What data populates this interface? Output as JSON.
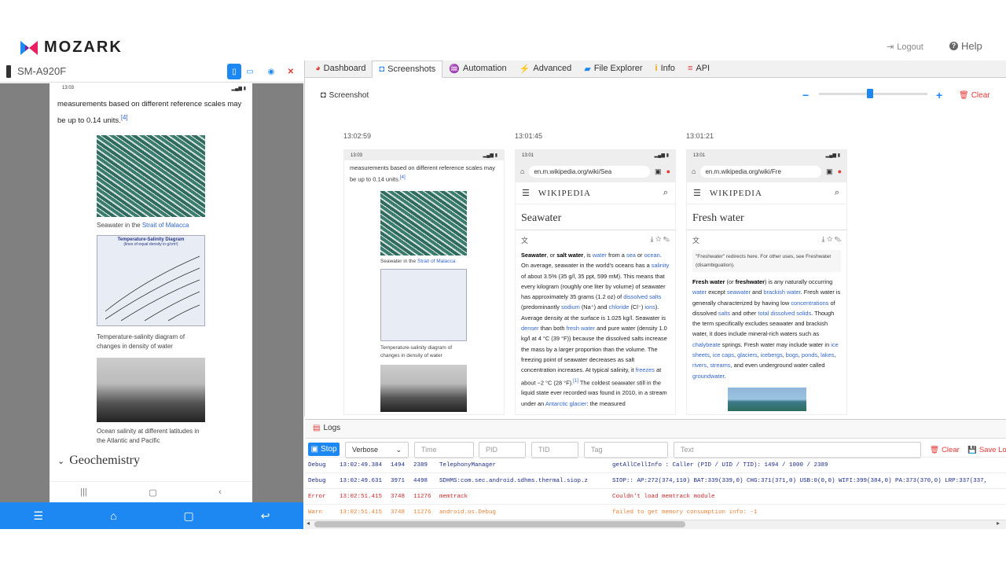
{
  "brand": {
    "name": "MOZARK",
    "logout": "Logout",
    "help": "Help"
  },
  "device": {
    "name": "SM-A920F"
  },
  "tabs": [
    {
      "label": "Dashboard",
      "icon": "dashboard-icon"
    },
    {
      "label": "Screenshots",
      "icon": "camera-icon",
      "active": true
    },
    {
      "label": "Automation",
      "icon": "automation-icon"
    },
    {
      "label": "Advanced",
      "icon": "bolt-icon"
    },
    {
      "label": "File Explorer",
      "icon": "folder-icon"
    },
    {
      "label": "Info",
      "icon": "info-icon"
    },
    {
      "label": "API",
      "icon": "api-icon"
    }
  ],
  "screenshot_toolbar": {
    "button": "Screenshot",
    "minus": "−",
    "plus": "+",
    "clear": "Clear"
  },
  "phone": {
    "status_time": "13:03",
    "intro": "measurements based on different reference scales may be up to 0.14 units.",
    "intro_ref": "[4]",
    "cap1_prefix": "Seawater in the ",
    "cap1_link": "Strait of Malacca",
    "chart_title": "Temperature-Salinity Diagram",
    "chart_sub": "(lines of equal density in g/cm³)",
    "cap2": "Temperature-salinity diagram of changes in density of water",
    "cap3": "Ocean salinity at different latitudes in the Atlantic and Pacific",
    "section": "Geochemistry"
  },
  "shots": [
    {
      "time": "13:02:59"
    },
    {
      "time": "13:01:45",
      "url": "en.m.wikipedia.org/wiki/Sea",
      "brand": "WIKIPEDIA",
      "title": "Seawater"
    },
    {
      "time": "13:01:21",
      "url": "en.m.wikipedia.org/wiki/Fre",
      "brand": "WIKIPEDIA",
      "title": "Fresh water",
      "hatnote": "\"Freshwater\" redirects here. For other uses, see Freshwater (disambiguation)."
    }
  ],
  "shot_status": {
    "s1": "13:03",
    "s2": "13:01",
    "s3": "13:01"
  },
  "seawater_text": {
    "p1": "Seawater",
    "p2": ", or ",
    "p3": "salt water",
    "p4": ", is ",
    "l1": "water",
    "p5": " from a ",
    "l2": "sea",
    "p6": " or ",
    "l3": "ocean",
    "p7": ". On average, seawater in the world's oceans has a ",
    "l4": "salinity",
    "p8": " of about 3.5% (35 g/l, 35 ppt, 599 mM). This means that every kilogram (roughly one liter by volume) of seawater has approximately 35 grams (1.2 oz) of ",
    "l5": "dissolved salts",
    "p9": " (predominantly ",
    "l6": "sodium",
    "p10": " (Na⁺) and ",
    "l7": "chloride",
    "p11": " (Cl⁻) ",
    "l8": "ions",
    "p12": "). Average density at the surface is 1.025 kg/l. Seawater is ",
    "l9": "denser",
    "p13": " than both ",
    "l10": "fresh water",
    "p14": " and pure water (density 1.0 kg/l at 4 °C (39 °F)) because the dissolved salts increase the mass by a larger proportion than the volume. The freezing point of seawater decreases as salt concentration increases. At typical salinity, it ",
    "l11": "freezes",
    "p15": " at about −2 °C (28 °F).",
    "ref": "[1]",
    "p16": " The coldest seawater still in the liquid state ever recorded was found in 2010, in a stream under an ",
    "l12": "Antarctic glacier",
    "p17": ": the measured"
  },
  "fresh_text": {
    "b1": "Fresh water",
    "t1": " (or ",
    "b2": "freshwater",
    "t2": ") is any naturally occurring ",
    "l1": "water",
    "t3": " except ",
    "l2": "seawater",
    "t4": " and ",
    "l3": "brackish water",
    "t5": ". Fresh water is generally characterized by having low ",
    "l4": "concentrations",
    "t6": " of dissolved ",
    "l5": "salts",
    "t7": " and other ",
    "l6": "total dissolved solids",
    "t8": ". Though the term specifically excludes seawater and brackish water, it does include mineral-rich waters such as ",
    "l7": "chalybeate",
    "t9": " springs. Fresh water may include water in ",
    "l8": "ice sheets",
    "t10": ", ",
    "l9": "ice caps",
    "t11": ", ",
    "l10": "glaciers",
    "t12": ", ",
    "l11": "icebergs",
    "t13": ", ",
    "l12": "bogs",
    "t14": ", ",
    "l13": "ponds",
    "t15": ", ",
    "l14": "lakes",
    "t16": ", ",
    "l15": "rivers",
    "t17": ", ",
    "l16": "streams",
    "t18": ", and even underground water called ",
    "l17": "groundwater",
    "t19": "."
  },
  "logs": {
    "tab": "Logs",
    "stop": "Stop",
    "level": "Verbose",
    "placeholders": {
      "time": "Time",
      "pid": "PID",
      "tid": "TID",
      "tag": "Tag",
      "text": "Text"
    },
    "clear": "Clear",
    "save": "Save Log",
    "rows": [
      {
        "level": "Debug",
        "time": "13:02:49.384",
        "pid": "1494",
        "tid": "2389",
        "tag": "TelephonyManager",
        "msg": "getAllCellInfo : Caller (PID / UID / TID): 1494 / 1000 / 2389",
        "color": "#1a2a8a"
      },
      {
        "level": "Debug",
        "time": "13:02:49.631",
        "pid": "3971",
        "tid": "4498",
        "tag": "SDHMS:com.sec.android.sdhms.thermal.siop.z",
        "msg": "SIOP:: AP:272(374,110) BAT:339(339,0) CHG:371(371,0) USB:0(0,0) WIFI:399(384,0) PA:373(370,0) LRP:337(337,",
        "color": "#1a2a8a"
      },
      {
        "level": "Error",
        "time": "13:02:51.415",
        "pid": "3748",
        "tid": "11276",
        "tag": "memtrack",
        "msg": "Couldn't load memtrack module",
        "color": "#c62828"
      },
      {
        "level": "Warn",
        "time": "13:02:51.415",
        "pid": "3748",
        "tid": "11276",
        "tag": "android.os.Debug",
        "msg": "failed to get memory consumption info: -1",
        "color": "#e8833a"
      }
    ]
  }
}
